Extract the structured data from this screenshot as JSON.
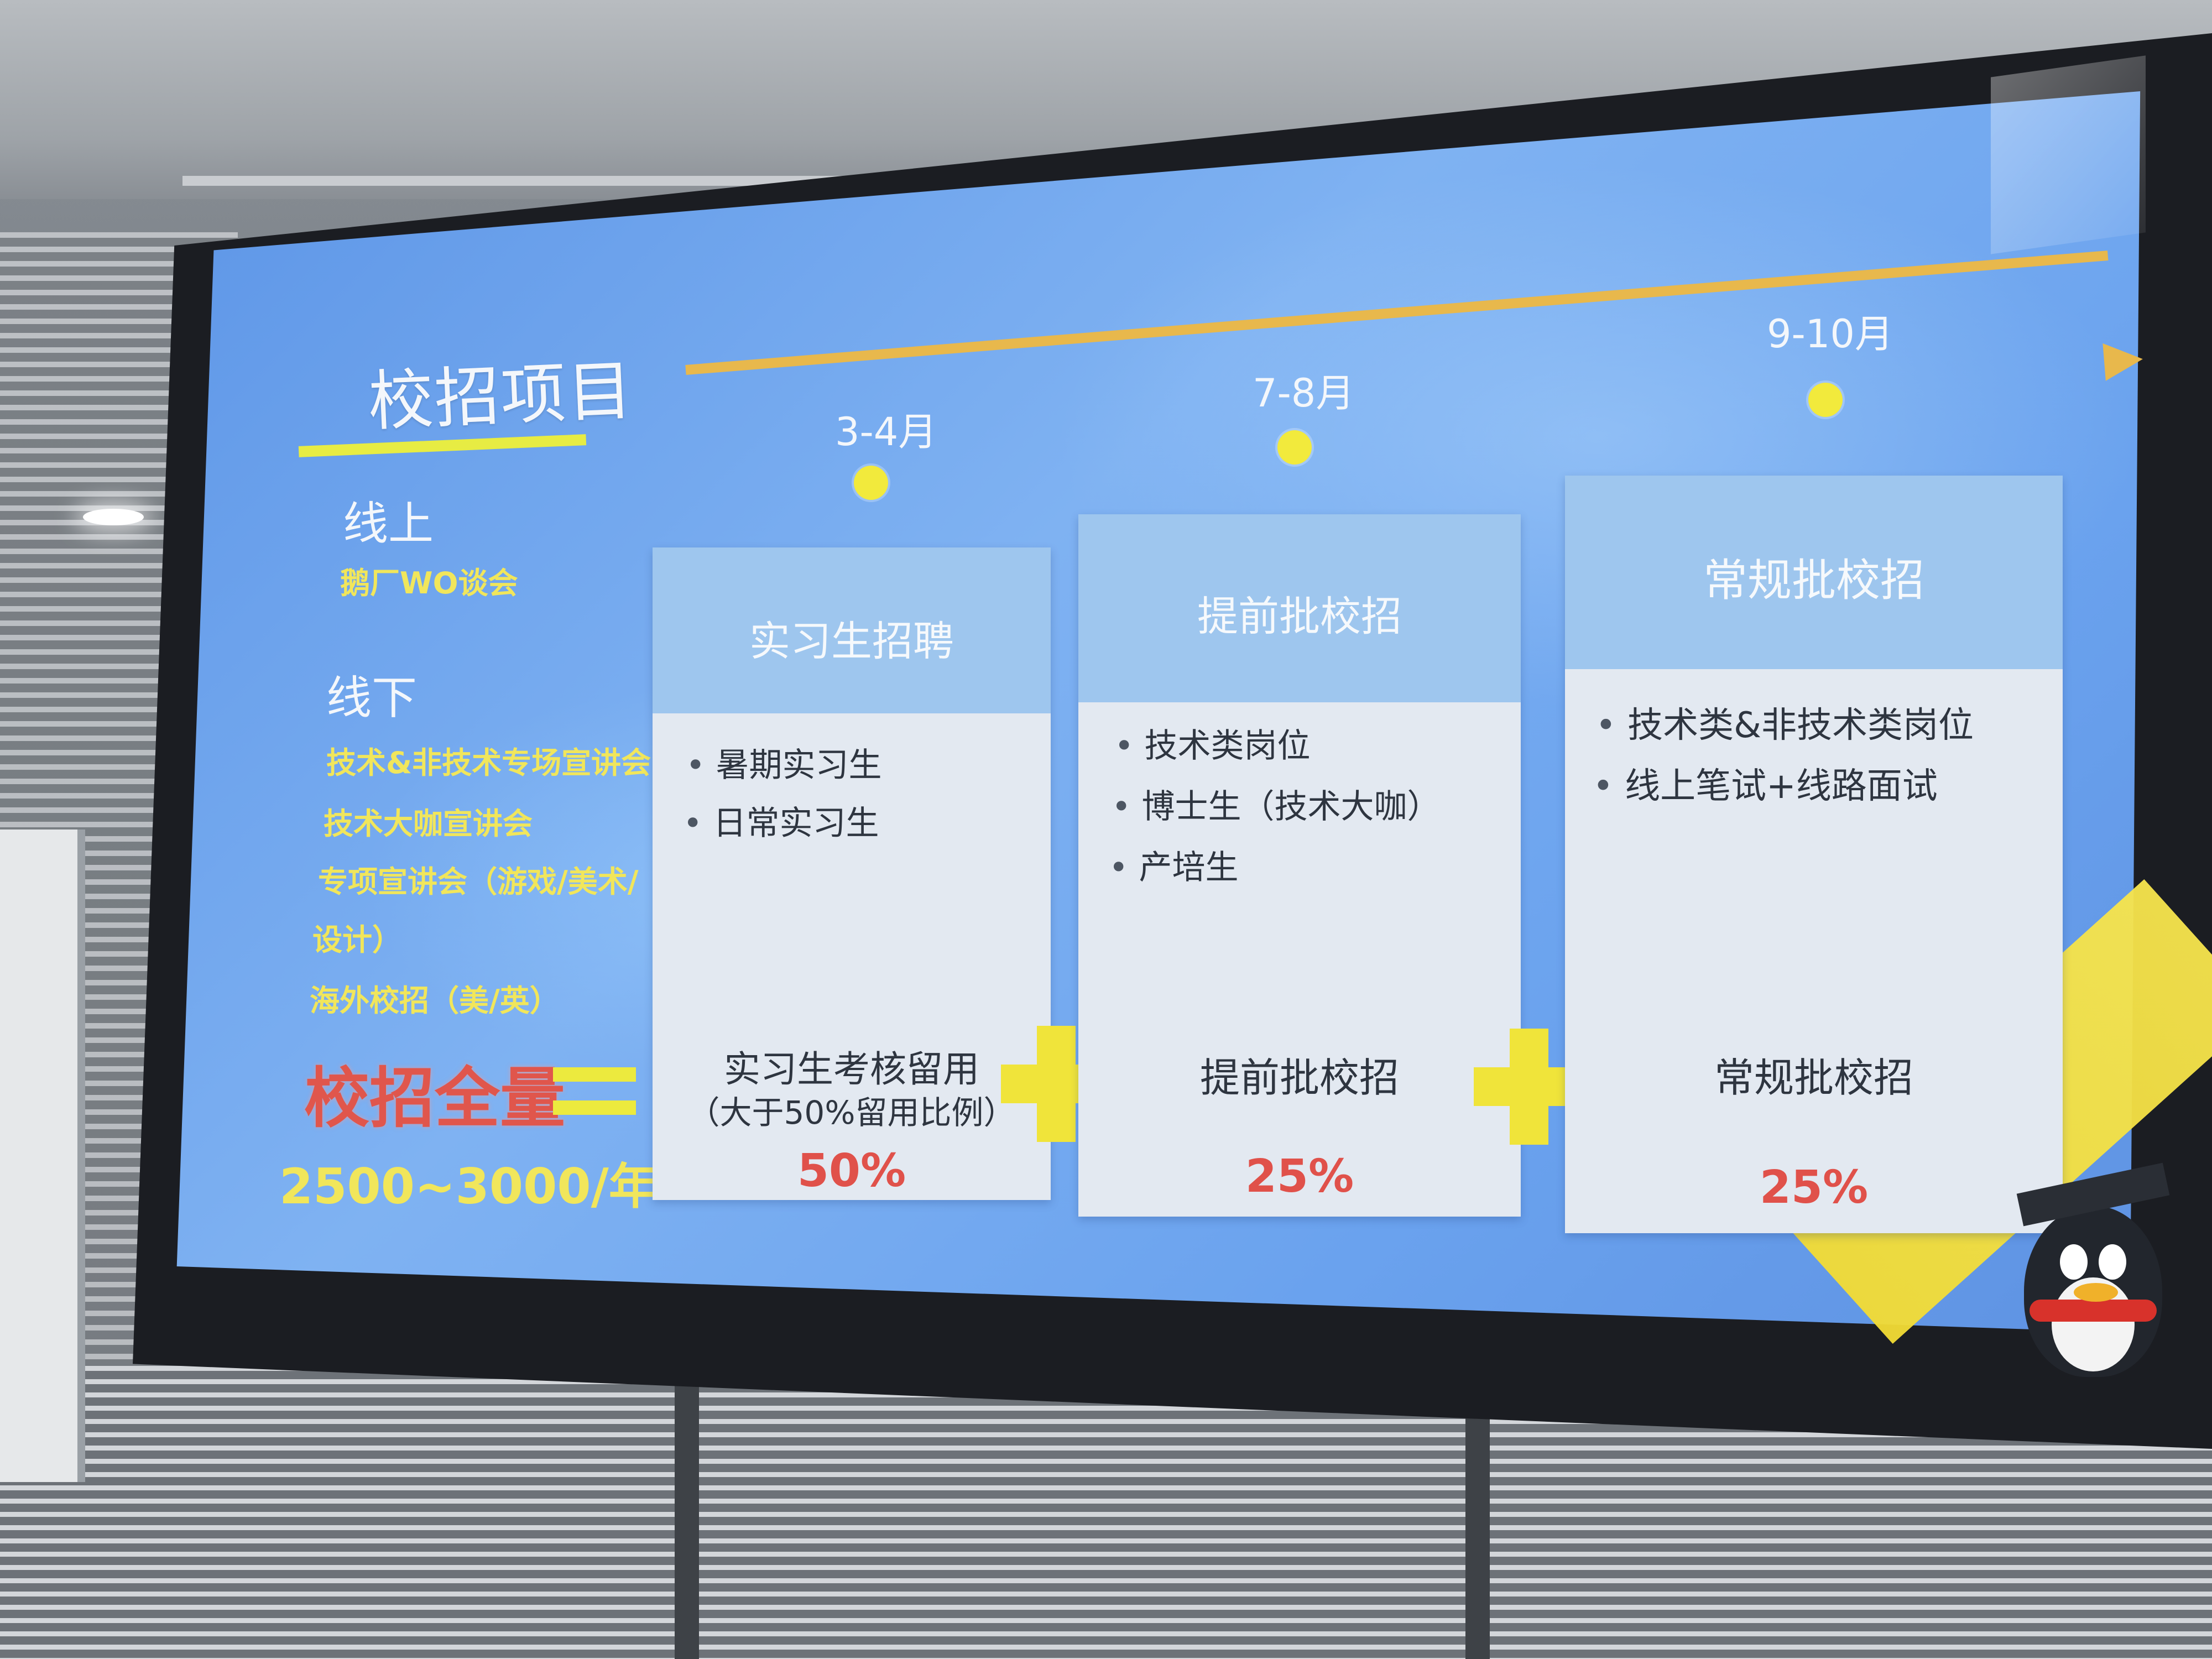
{
  "slide": {
    "title": "校招项目",
    "online": {
      "heading": "线上",
      "items": [
        "鹅厂WO谈会"
      ]
    },
    "offline": {
      "heading": "线下",
      "items": [
        "技术&非技术专场宣讲会",
        "技术大咖宣讲会",
        "专项宣讲会（游戏/美术/",
        "设计）",
        "海外校招（美/英）"
      ]
    },
    "total": {
      "label": "校招全量",
      "value": "2500~3000/年"
    },
    "timeline": {
      "dates": [
        "3-4月",
        "7-8月",
        "9-10月"
      ]
    },
    "cards": [
      {
        "title": "实习生招聘",
        "bullets": [
          "暑期实习生",
          "日常实习生"
        ],
        "footer": "实习生考核留用",
        "note": "（大于50%留用比例）",
        "percent": "50%"
      },
      {
        "title": "提前批校招",
        "bullets": [
          "技术类岗位",
          "博士生（技术大咖）",
          "产培生"
        ],
        "footer": "提前批校招",
        "note": "",
        "percent": "25%"
      },
      {
        "title": "常规批校招",
        "bullets": [
          "技术类&非技术类岗位",
          "线上笔试+线路面试"
        ],
        "footer": "常规批校招",
        "note": "",
        "percent": "25%"
      }
    ],
    "colors": {
      "accent_yellow": "#f0e43a",
      "percent_red": "#e0514a",
      "timeline": "#e8b84c",
      "slide_blue": "#6aa2ee"
    },
    "icons": {
      "mascot": "penguin-mascot-icon",
      "plus": "plus-icon",
      "equals": "equals-icon"
    }
  }
}
